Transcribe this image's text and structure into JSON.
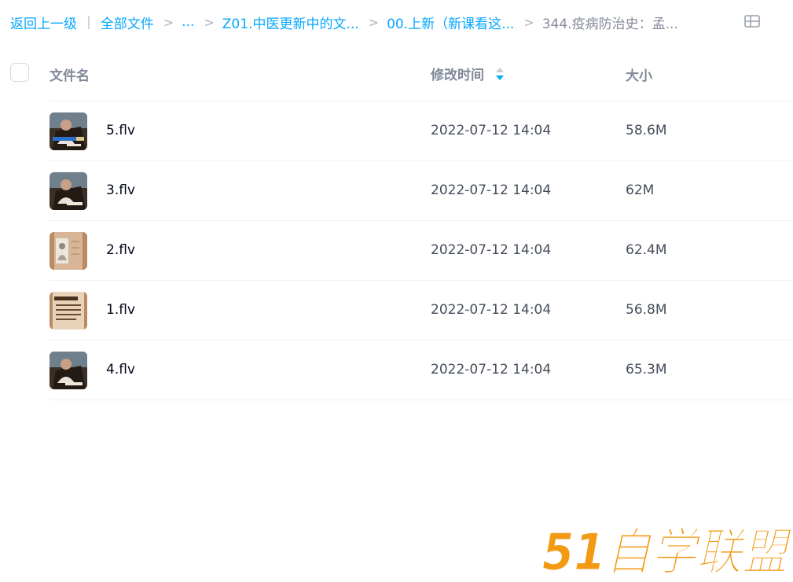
{
  "breadcrumb": {
    "back": "返回上一级",
    "pipe": "|",
    "items": [
      "全部文件",
      "...",
      "Z01.中医更新中的文...",
      "00.上新（新课看这...",
      "344.疫病防治史：孟..."
    ],
    "separator": ">"
  },
  "table": {
    "headers": {
      "name": "文件名",
      "time": "修改时间",
      "size": "大小"
    },
    "rows": [
      {
        "name": "5.flv",
        "time": "2022-07-12 14:04",
        "size": "58.6M",
        "thumb": "video-frame-lecturer"
      },
      {
        "name": "3.flv",
        "time": "2022-07-12 14:04",
        "size": "62M",
        "thumb": "video-frame-lecturer"
      },
      {
        "name": "2.flv",
        "time": "2022-07-12 14:04",
        "size": "62.4M",
        "thumb": "video-frame-scroll-portrait"
      },
      {
        "name": "1.flv",
        "time": "2022-07-12 14:04",
        "size": "56.8M",
        "thumb": "video-frame-title-text"
      },
      {
        "name": "4.flv",
        "time": "2022-07-12 14:04",
        "size": "65.3M",
        "thumb": "video-frame-lecturer"
      }
    ]
  },
  "watermark": {
    "text": "51自学联盟"
  },
  "colors": {
    "link": "#06a7ff",
    "watermark": "#f39a14",
    "header_text": "#818999"
  }
}
